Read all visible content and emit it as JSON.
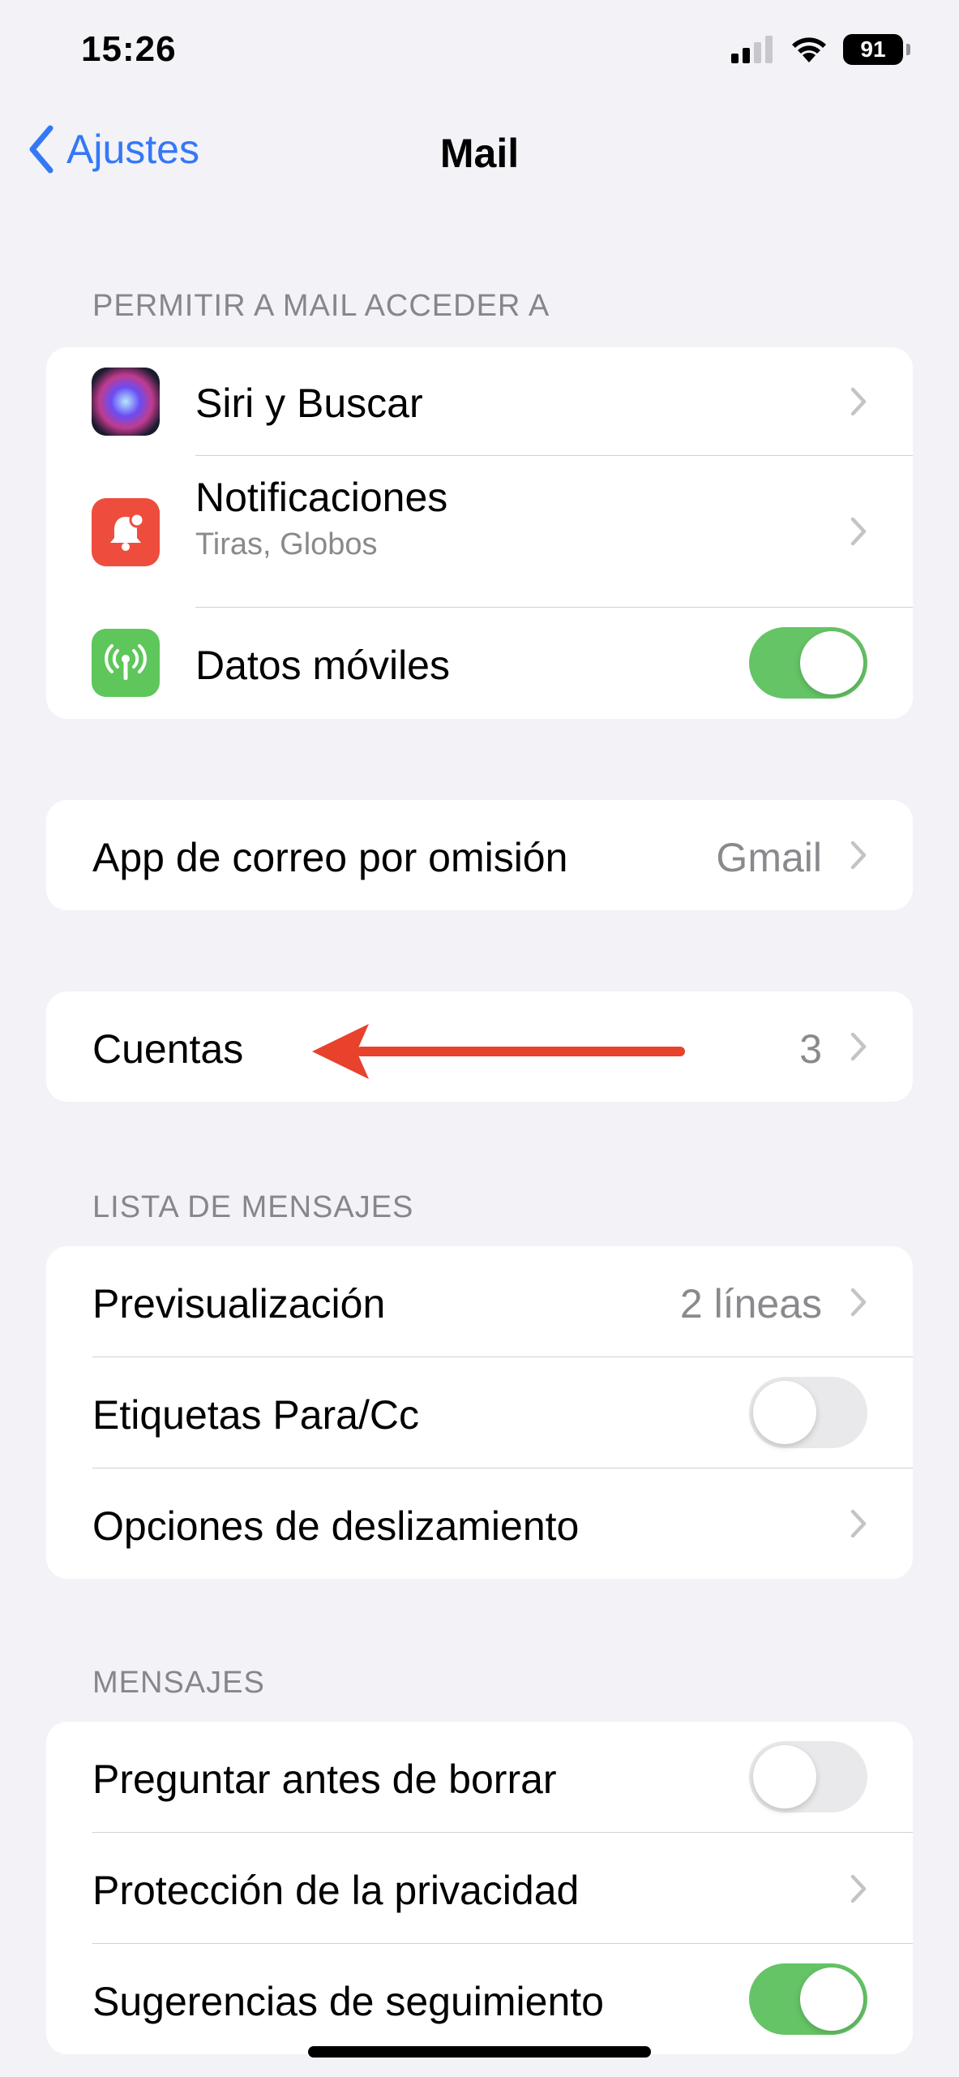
{
  "status_bar": {
    "time": "15:26",
    "battery": "91",
    "icons": [
      "cellular-signal-icon",
      "wifi-icon",
      "battery-icon"
    ]
  },
  "nav": {
    "back_label": "Ajustes",
    "title": "Mail"
  },
  "sections": {
    "access_header": "PERMITIR A MAIL ACCEDER A",
    "message_list_header": "LISTA DE MENSAJES",
    "messages_header": "MENSAJES"
  },
  "access": {
    "siri": {
      "label": "Siri y Buscar",
      "icon": "siri-icon"
    },
    "notifications": {
      "label": "Notificaciones",
      "sublabel": "Tiras, Globos",
      "icon": "bell-icon"
    },
    "mobile_data": {
      "label": "Datos móviles",
      "icon": "antenna-icon",
      "enabled": true
    }
  },
  "default_app": {
    "label": "App de correo por omisión",
    "value": "Gmail"
  },
  "accounts": {
    "label": "Cuentas",
    "value": "3"
  },
  "message_list": {
    "preview": {
      "label": "Previsualización",
      "value": "2 líneas"
    },
    "to_cc": {
      "label": "Etiquetas Para/Cc",
      "enabled": false
    },
    "swipe": {
      "label": "Opciones de deslizamiento"
    }
  },
  "messages": {
    "ask_delete": {
      "label": "Preguntar antes de borrar",
      "enabled": false
    },
    "privacy": {
      "label": "Protección de la privacidad"
    },
    "follow_up": {
      "label": "Sugerencias de seguimiento",
      "enabled": true
    }
  },
  "colors": {
    "accent": "#3478f6",
    "toggle_on": "#65c466",
    "toggle_off": "#e9e9eb",
    "arrow": "#e8412c",
    "notifications_icon": "#ee4d3d",
    "mobile_data_icon": "#5ec65b"
  }
}
